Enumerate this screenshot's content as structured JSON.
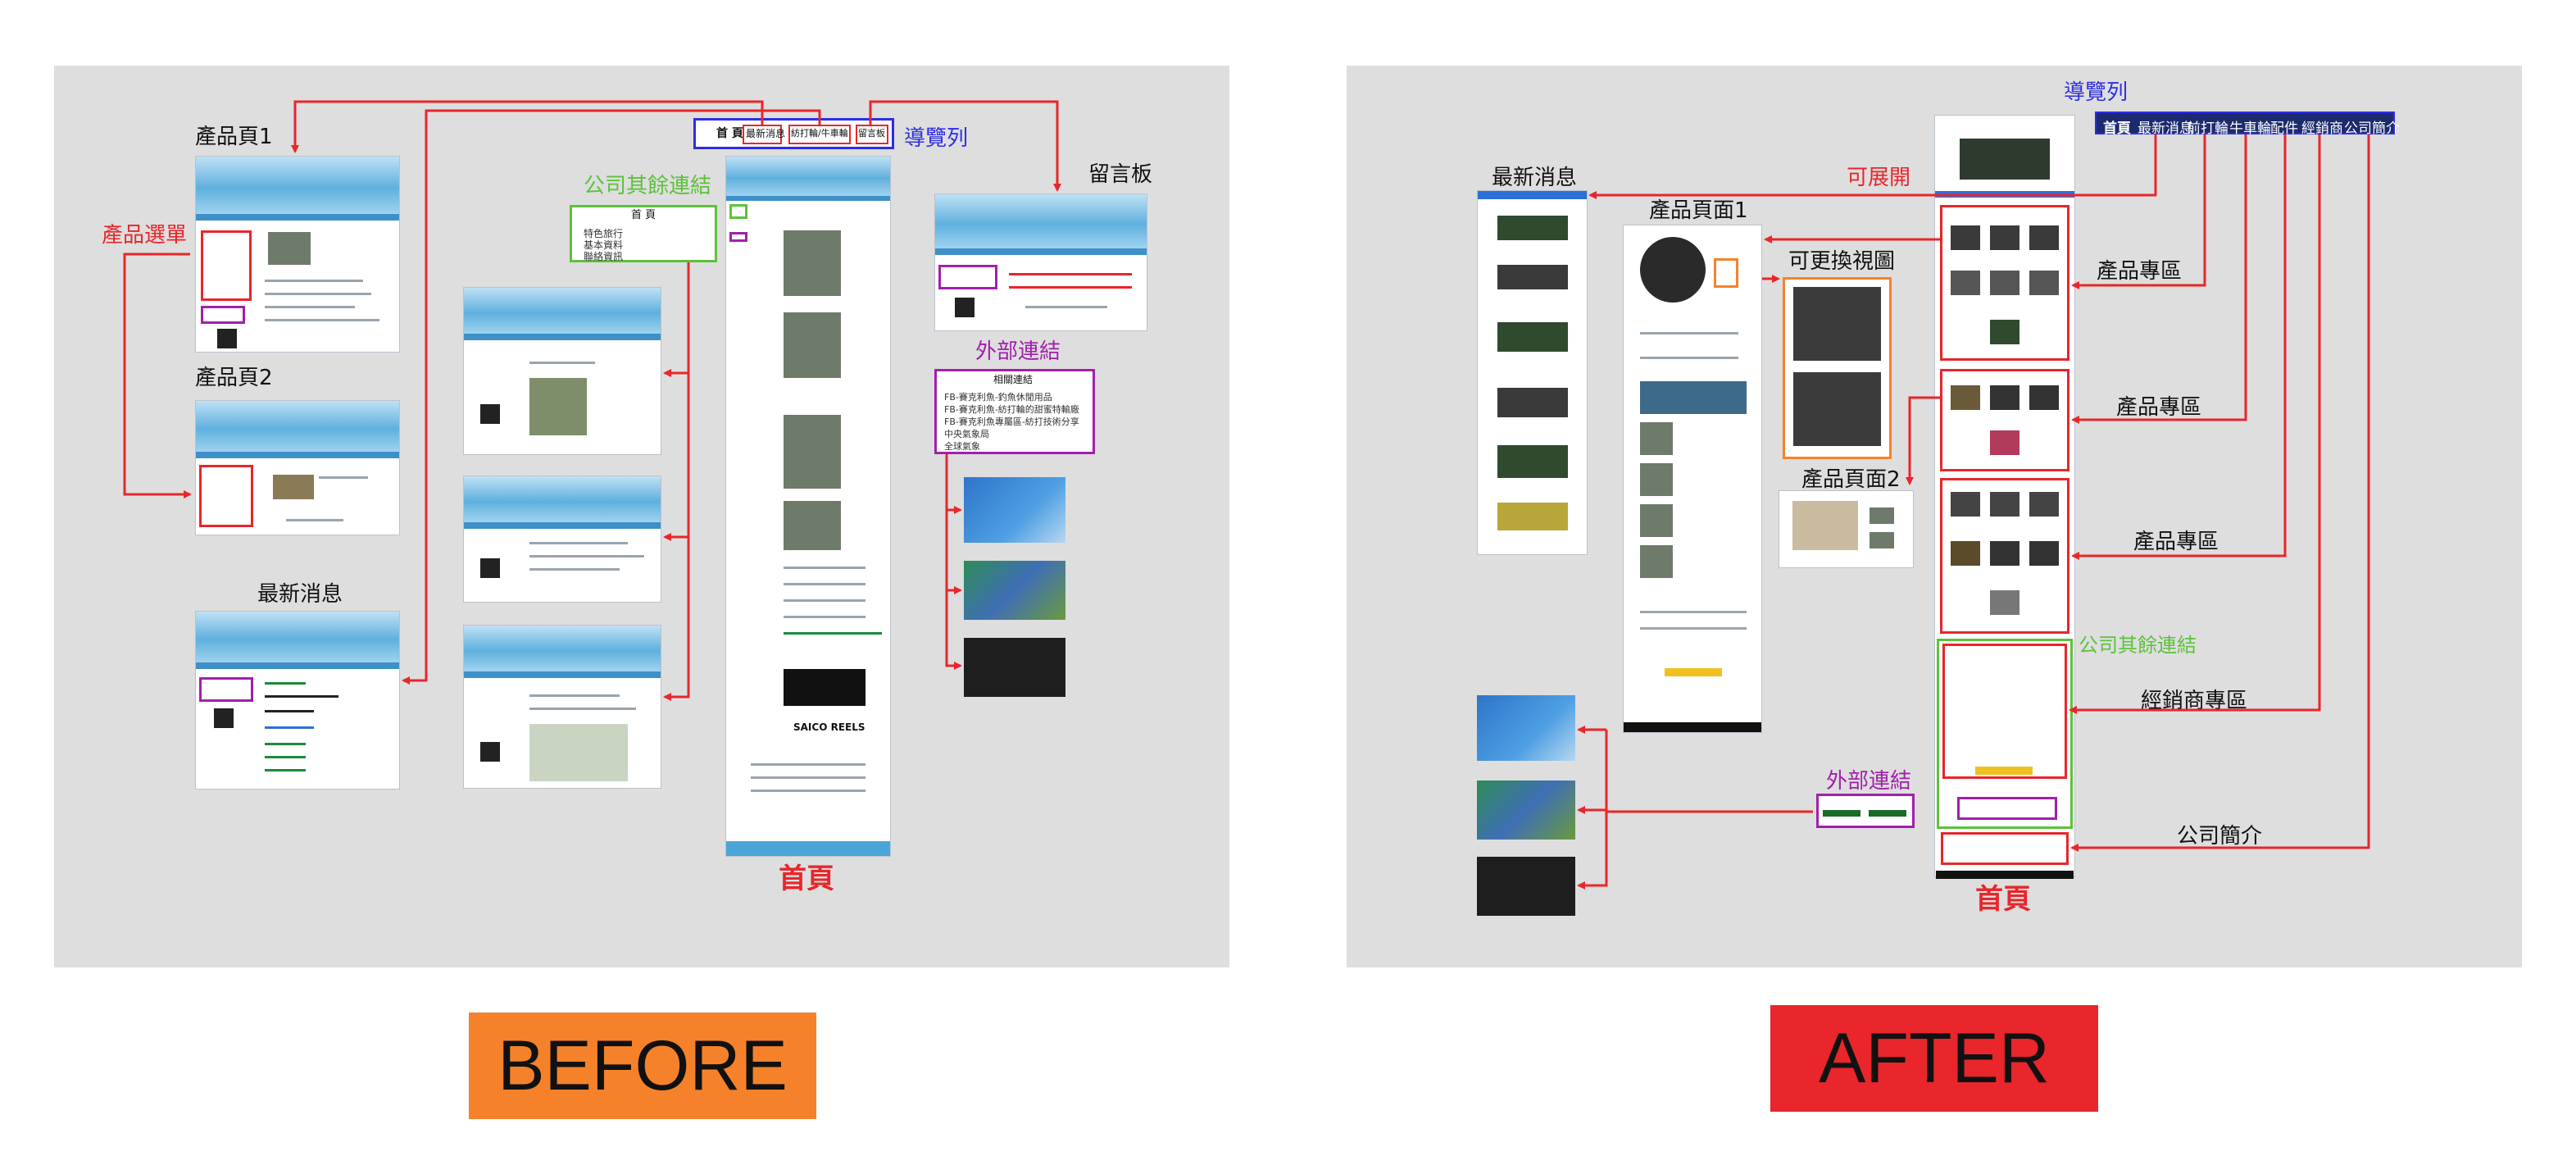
{
  "colors": {
    "red": "#e8262b",
    "blue": "#2d2de8",
    "green": "#5cc23a",
    "purple": "#a21fae",
    "orange": "#f5822a",
    "panel": "#dedede"
  },
  "before": {
    "badge": "BEFORE",
    "labels": {
      "product_page_1": "產品頁1",
      "product_page_2": "產品頁2",
      "latest_news": "最新消息",
      "product_menu": "產品選單",
      "company_other_links": "公司其餘連結",
      "nav_bar": "導覽列",
      "guestbook": "留言板",
      "external_links": "外部連結",
      "home_page": "首頁"
    },
    "nav_items": [
      "首 頁",
      "最新消息",
      "紡打輪/牛車輪",
      "留言板"
    ],
    "company_box": {
      "title": "首 頁",
      "items": [
        "特色旅行",
        "基本資料",
        "聯絡資訊"
      ]
    },
    "external_box": {
      "title": "相關連結",
      "items": [
        "FB-賽克利魚-釣魚休閒用品",
        "FB-賽克利魚-紡打輪的甜蜜特輸廠",
        "FB-賽克利魚專屬區-紡打技術分享",
        "中央氣象局",
        "全球氣象"
      ]
    },
    "home_caption": "SAICO REELS"
  },
  "after": {
    "badge": "AFTER",
    "labels": {
      "nav_bar": "導覽列",
      "expandable": "可展開",
      "latest_news": "最新消息",
      "product_page_1": "產品頁面1",
      "swappable_view": "可更換視圖",
      "product_page_2": "產品頁面2",
      "product_zone_1": "產品專區",
      "product_zone_2": "產品專區",
      "product_zone_3": "產品專區",
      "company_other_links": "公司其餘連結",
      "dealer_zone": "經銷商專區",
      "company_intro": "公司簡介",
      "external_links": "外部連結",
      "home_page": "首頁"
    },
    "nav_items": [
      "首頁",
      "最新消息",
      "前打輪",
      "牛車輪",
      "配件",
      "經銷商",
      "公司簡介"
    ]
  }
}
